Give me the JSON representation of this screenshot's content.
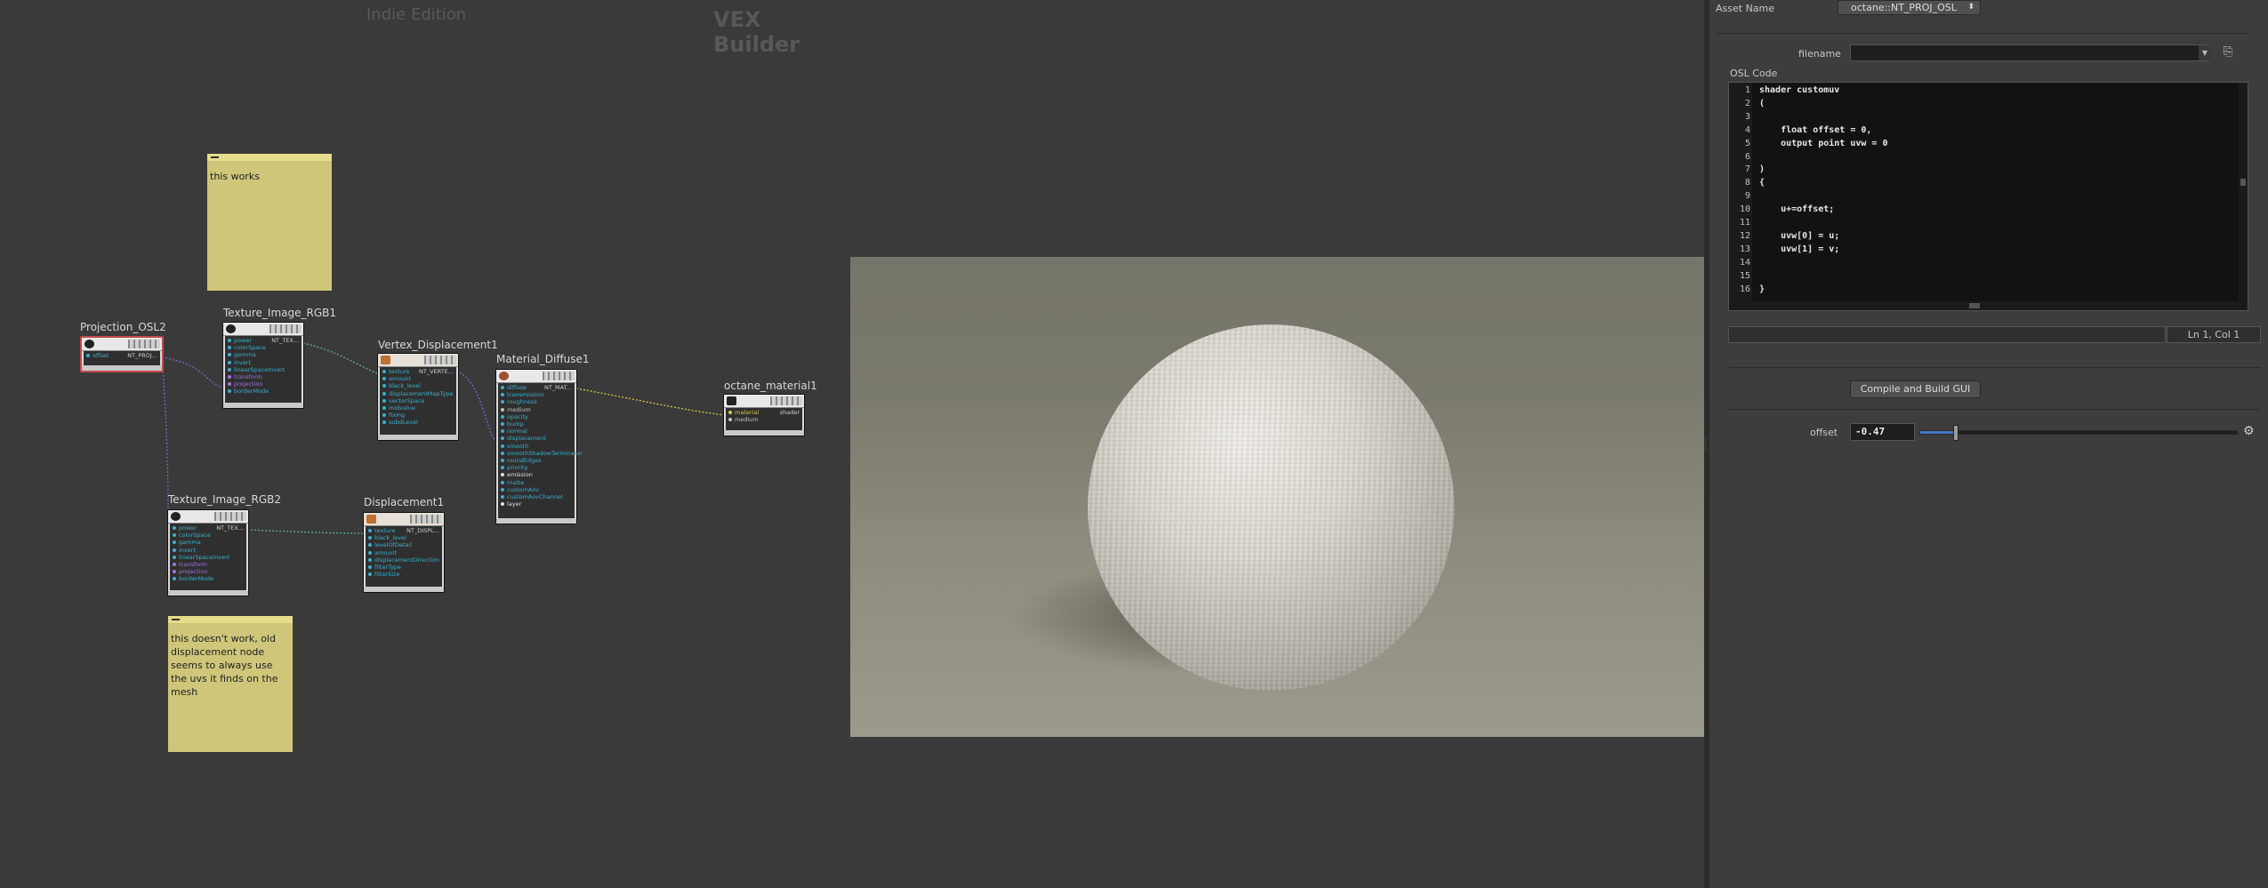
{
  "network": {
    "edition": "Indie Edition",
    "title": "VEX Builder",
    "sticky_notes": [
      {
        "text": "this works"
      },
      {
        "text": "this doesn't work, old displacement node seems to always use the uvs it finds on the mesh"
      }
    ],
    "nodes": {
      "projection": {
        "name": "Projection_OSL2",
        "output": "NT_PROJ...",
        "inputs": [
          "offset"
        ]
      },
      "tex1": {
        "name": "Texture_Image_RGB1",
        "output": "NT_TEX...",
        "inputs": [
          "power",
          "colorSpace",
          "gamma",
          "invert",
          "linearSpaceInvert",
          "transform",
          "projection",
          "borderMode"
        ]
      },
      "vdisp": {
        "name": "Vertex_Displacement1",
        "output": "NT_VERTE...",
        "inputs": [
          "texture",
          "amount",
          "black_level",
          "displacementMapType",
          "vectorSpace",
          "midvalue",
          "fixing",
          "subdLevel"
        ]
      },
      "mat": {
        "name": "Material_Diffuse1",
        "output": "NT_MAT...",
        "inputs": [
          "diffuse",
          "transmission",
          "roughness",
          "medium",
          "opacity",
          "bump",
          "normal",
          "displacement",
          "smooth",
          "smoothShadowTerminator",
          "roundEdges",
          "priority",
          "emission",
          "matte",
          "customAov",
          "customAovChannel",
          "layer"
        ]
      },
      "octmat": {
        "name": "octane_material1",
        "output": "shader",
        "inputs": [
          "material",
          "medium"
        ]
      },
      "tex2": {
        "name": "Texture_Image_RGB2",
        "output": "NT_TEX...",
        "inputs": [
          "power",
          "colorSpace",
          "gamma",
          "invert",
          "linearSpaceInvert",
          "transform",
          "projection",
          "borderMode"
        ]
      },
      "disp": {
        "name": "Displacement1",
        "output": "NT_DISPL...",
        "inputs": [
          "texture",
          "black_level",
          "levelOfDetail",
          "amount",
          "displacementDirection",
          "filterType",
          "filterSize"
        ]
      }
    }
  },
  "params": {
    "asset_label": "Asset Name",
    "asset_value": "octane::NT_PROJ_OSL",
    "filename_label": "filename",
    "filename_value": "",
    "osl_label": "OSL Code",
    "code_lines": [
      "shader customuv",
      "(",
      "",
      "    float offset = 0,",
      "    output point uvw = 0",
      "",
      ")",
      "{",
      "",
      "    u+=offset;",
      "",
      "    uvw[0] = u;",
      "    uvw[1] = v;",
      "",
      "",
      "}"
    ],
    "status": "Ln 1, Col 1",
    "compile_button": "Compile and Build GUI",
    "offset_label": "offset",
    "offset_value": "-0.47",
    "offset_slider_fraction": 0.11
  }
}
